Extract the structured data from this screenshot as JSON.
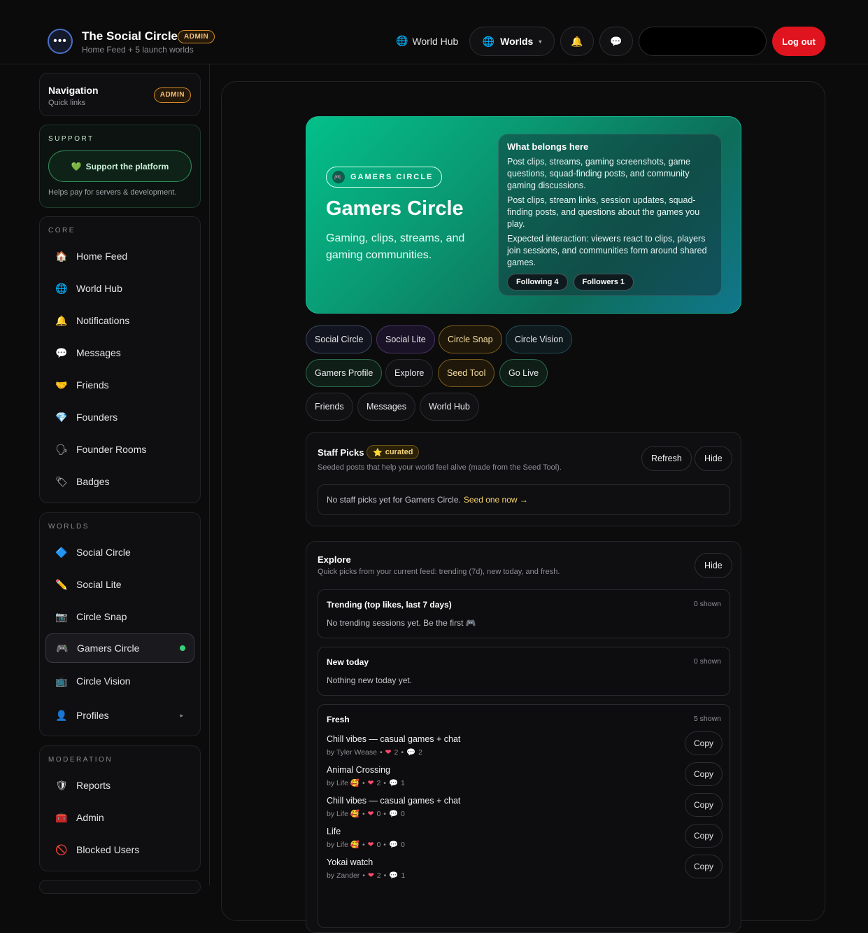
{
  "header": {
    "title": "The Social Circle",
    "badge": "ADMIN",
    "subtitle": "Home Feed + 5 launch worlds",
    "logo_icon": "•••",
    "world_hub": "World Hub",
    "worlds": "Worlds",
    "logout": "Log out",
    "bell_icon": "🔔",
    "chat_icon": "💬",
    "globe_icon": "🌐",
    "chevron_icon": "▾"
  },
  "sidebar": {
    "nav": {
      "title": "Navigation",
      "sub": "Quick links",
      "badge": "ADMIN"
    },
    "support": {
      "label": "SUPPORT",
      "button": "Support the platform",
      "heart_icon": "💚",
      "note": "Helps pay for servers & development."
    },
    "core": {
      "label": "CORE",
      "items": [
        {
          "icon": "🏠",
          "label": "Home Feed"
        },
        {
          "icon": "🌐",
          "label": "World Hub"
        },
        {
          "icon": "🔔",
          "label": "Notifications"
        },
        {
          "icon": "💬",
          "label": "Messages"
        },
        {
          "icon": "🤝",
          "label": "Friends"
        },
        {
          "icon": "💎",
          "label": "Founders"
        },
        {
          "icon": "🗣",
          "label": "Founder Rooms"
        },
        {
          "icon": "🏷",
          "label": "Badges"
        }
      ]
    },
    "worlds": {
      "label": "WORLDS",
      "items": [
        {
          "icon": "🔷",
          "label": "Social Circle"
        },
        {
          "icon": "✏️",
          "label": "Social Lite"
        },
        {
          "icon": "📷",
          "label": "Circle Snap"
        },
        {
          "icon": "🎮",
          "label": "Gamers Circle"
        },
        {
          "icon": "📺",
          "label": "Circle Vision"
        },
        {
          "icon": "👤",
          "label": "Profiles"
        }
      ],
      "chevron": "▸"
    },
    "moderation": {
      "label": "MODERATION",
      "items": [
        {
          "icon": "🛡",
          "label": "Reports"
        },
        {
          "icon": "🧰",
          "label": "Admin"
        },
        {
          "icon": "🚫",
          "label": "Blocked Users"
        }
      ]
    }
  },
  "hero": {
    "tag": "GAMERS CIRCLE",
    "tag_icon": "🎮",
    "title": "Gamers Circle",
    "subtitle": "Gaming, clips, streams, and gaming communities.",
    "box_title": "What belongs here",
    "p1": "Post clips, streams, gaming screenshots, game questions, squad-finding posts, and community gaming discussions.",
    "p2": "Post clips, stream links, session updates, squad-finding posts, and questions about the games you play.",
    "p3": "Expected interaction: viewers react to clips, players join sessions, and communities form around shared games.",
    "following": "Following 4",
    "followers": "Followers 1"
  },
  "chips": [
    "Social Circle",
    "Social Lite",
    "Circle Snap",
    "Circle Vision",
    "Gamers Profile",
    "Explore",
    "Seed Tool",
    "Go Live",
    "Friends",
    "Messages",
    "World Hub"
  ],
  "staff": {
    "title": "Staff Picks",
    "curated": "curated",
    "star_icon": "⭐",
    "desc": "Seeded posts that help your world feel alive (made from the Seed Tool).",
    "refresh": "Refresh",
    "hide": "Hide",
    "empty": "No staff picks yet for Gamers Circle.",
    "seed_link": "Seed one now →"
  },
  "explore": {
    "title": "Explore",
    "desc": "Quick picks from your current feed: trending (7d), new today, and fresh.",
    "hide": "Hide",
    "trending": {
      "title": "Trending (top likes, last 7 days)",
      "count": "0 shown",
      "text": "No trending sessions yet. Be the first 🎮"
    },
    "new_today": {
      "title": "New today",
      "count": "0 shown",
      "text": "Nothing new today yet."
    },
    "fresh": {
      "title": "Fresh",
      "count": "5 shown",
      "copy": "Copy",
      "posts": [
        {
          "title": "Chill vibes — casual games + chat",
          "author": "by Tyler Wease",
          "likes": "2",
          "comments": "2"
        },
        {
          "title": "Animal Crossing",
          "author": "by Life 🥰",
          "likes": "2",
          "comments": "1"
        },
        {
          "title": "Chill vibes — casual games + chat",
          "author": "by Life 🥰",
          "likes": "0",
          "comments": "0"
        },
        {
          "title": "Life",
          "author": "by Life 🥰",
          "likes": "0",
          "comments": "0"
        },
        {
          "title": "Yokai watch",
          "author": "by Zander",
          "likes": "2",
          "comments": "1"
        }
      ]
    }
  }
}
